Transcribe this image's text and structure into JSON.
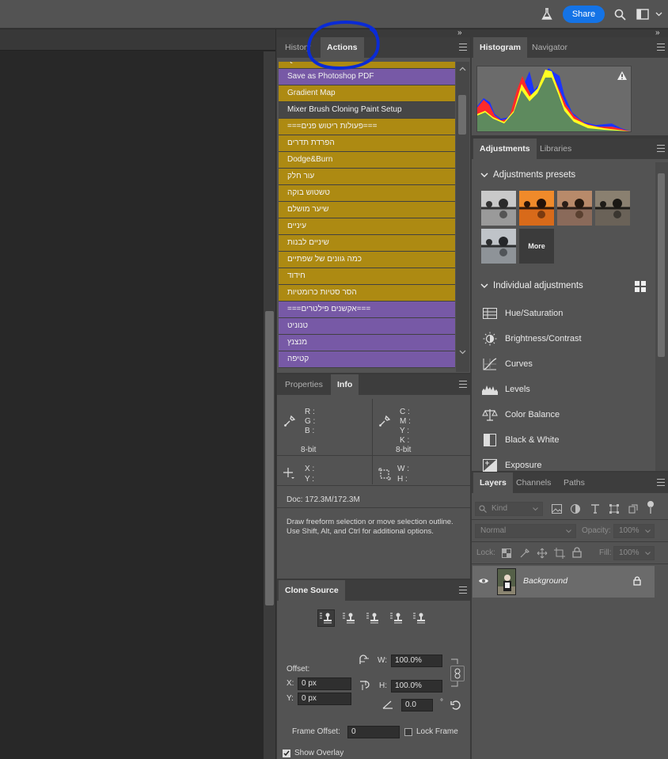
{
  "topbar": {
    "share_label": "Share"
  },
  "actions_panel": {
    "tabs": [
      "History",
      "Actions"
    ],
    "active_tab": "Actions",
    "items": [
      {
        "label": "Quadrant Colors",
        "color": "gold"
      },
      {
        "label": "Save as Photoshop PDF",
        "color": "purple"
      },
      {
        "label": "Gradient Map",
        "color": "gold"
      },
      {
        "label": "Mixer Brush Cloning Paint Setup",
        "color": "dark"
      },
      {
        "label": "===פעולות ריטוש פנים===",
        "color": "gold"
      },
      {
        "label": "הפרדת תדרים",
        "color": "gold"
      },
      {
        "label": "Dodge&Burn",
        "color": "gold"
      },
      {
        "label": "עור חלק",
        "color": "gold"
      },
      {
        "label": "טשטוש בוקה",
        "color": "gold"
      },
      {
        "label": "שיער מושלם",
        "color": "gold"
      },
      {
        "label": "עיניים",
        "color": "gold"
      },
      {
        "label": "שיניים לבנות",
        "color": "gold"
      },
      {
        "label": "כמה גוונים של שפתיים",
        "color": "gold"
      },
      {
        "label": "חידוד",
        "color": "gold"
      },
      {
        "label": "הסר סטיות כרומטיות",
        "color": "gold"
      },
      {
        "label": "===אקשנים פילטרים===",
        "color": "purple"
      },
      {
        "label": "טנוניט",
        "color": "purple"
      },
      {
        "label": "מנצנץ",
        "color": "purple"
      },
      {
        "label": "קטיפה",
        "color": "purple"
      }
    ]
  },
  "info_panel": {
    "tabs": [
      "Properties",
      "Info"
    ],
    "rgb_labels": [
      "R :",
      "G :",
      "B :"
    ],
    "cmyk_labels": [
      "C :",
      "M :",
      "Y :",
      "K :"
    ],
    "bit_left": "8-bit",
    "bit_right": "8-bit",
    "xy_labels": [
      "X :",
      "Y :"
    ],
    "wh_labels": [
      "W :",
      "H :"
    ],
    "doc": "Doc: 172.3M/172.3M",
    "hint": "Draw freeform selection or move selection outline.  Use Shift, Alt, and Ctrl for additional options."
  },
  "clone_source": {
    "tab": "Clone Source",
    "offset_label": "Offset:",
    "x_label": "X:",
    "x_value": "0 px",
    "y_label": "Y:",
    "y_value": "0 px",
    "w_label": "W:",
    "w_value": "100.0%",
    "h_label": "H:",
    "h_value": "100.0%",
    "angle_value": "0.0",
    "degree": "°",
    "frame_offset_label": "Frame Offset:",
    "frame_offset_value": "0",
    "lock_frame_label": "Lock Frame",
    "show_overlay_label": "Show Overlay"
  },
  "histogram_panel": {
    "tabs": [
      "Histogram",
      "Navigator"
    ]
  },
  "adjustments_panel": {
    "tabs": [
      "Adjustments",
      "Libraries"
    ],
    "presets_title": "Adjustments presets",
    "more_label": "More",
    "individual_title": "Individual adjustments",
    "items": [
      "Hue/Saturation",
      "Brightness/Contrast",
      "Curves",
      "Levels",
      "Color Balance",
      "Black & White",
      "Exposure"
    ]
  },
  "layers_panel": {
    "tabs": [
      "Layers",
      "Channels",
      "Paths"
    ],
    "kind_placeholder": "Kind",
    "blend_mode": "Normal",
    "opacity_label": "Opacity:",
    "opacity_value": "100%",
    "lock_label": "Lock:",
    "fill_label": "Fill:",
    "fill_value": "100%",
    "layer_name": "Background"
  }
}
